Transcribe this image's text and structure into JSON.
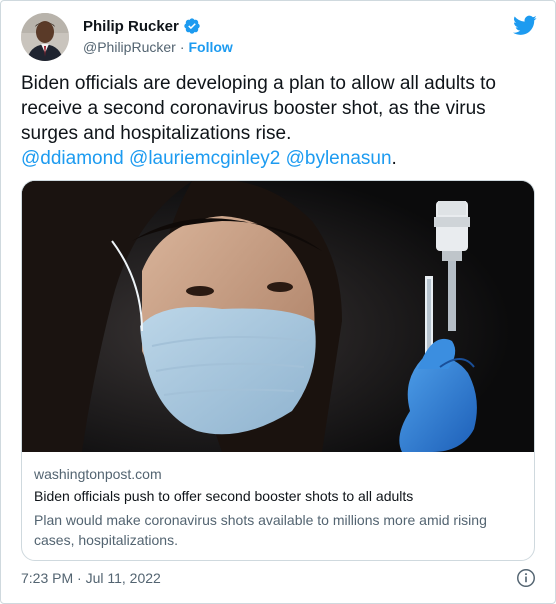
{
  "author": {
    "display_name": "Philip Rucker",
    "handle": "@PhilipRucker",
    "separator": "·",
    "follow_label": "Follow"
  },
  "tweet": {
    "text": "Biden officials are developing a plan to allow all adults to receive a second coronavirus booster shot, as the virus surges and hospitalizations rise.",
    "mentions": [
      "@ddiamond",
      "@lauriemcginley2",
      "@bylenasun"
    ],
    "mention_trailing": "."
  },
  "link_card": {
    "domain": "washingtonpost.com",
    "title": "Biden officials push to offer second booster shots to all adults",
    "description": "Plan would make coronavirus shots available to millions more amid rising cases, hospitalizations."
  },
  "footer": {
    "timestamp": "7:23 PM · Jul 11, 2022"
  },
  "icons": {
    "verified": "verified-badge-icon",
    "brand": "twitter-bird-icon",
    "info": "info-icon"
  },
  "colors": {
    "accent": "#1d9bf0",
    "text_primary": "#0f1419",
    "text_secondary": "#536471",
    "border": "#cfd9de"
  }
}
